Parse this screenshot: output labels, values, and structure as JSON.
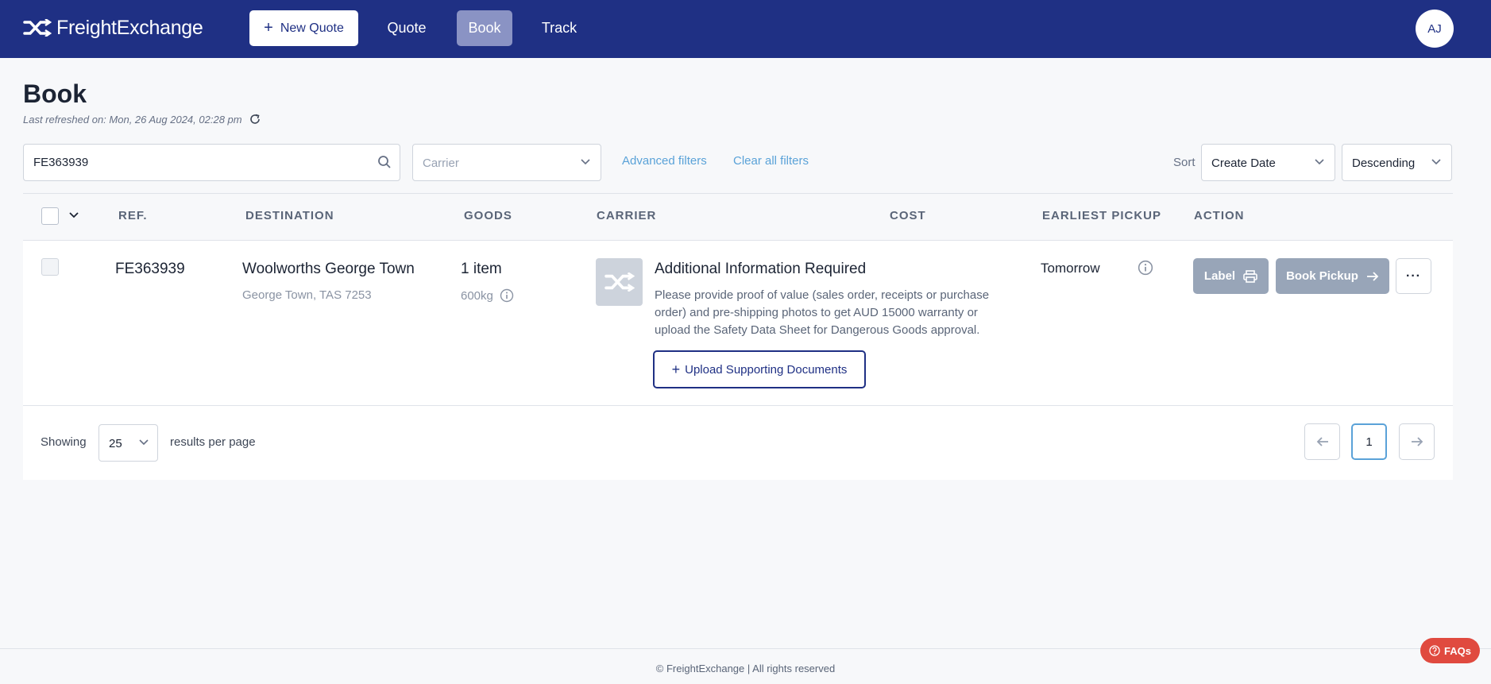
{
  "header": {
    "brand": "FreightExchange",
    "new_quote_label": "New Quote",
    "nav": {
      "quote": "Quote",
      "book": "Book",
      "track": "Track"
    },
    "active_nav": "Book",
    "user_initials": "AJ"
  },
  "page": {
    "title": "Book",
    "last_refreshed": "Last refreshed on: Mon, 26 Aug 2024, 02:28 pm"
  },
  "filters": {
    "search_value": "FE363939",
    "carrier_placeholder": "Carrier",
    "advanced_filters_label": "Advanced filters",
    "clear_filters_label": "Clear all filters",
    "sort_label": "Sort",
    "sort_by": "Create Date",
    "sort_order": "Descending"
  },
  "table": {
    "columns": {
      "ref": "REF.",
      "destination": "DESTINATION",
      "goods": "GOODS",
      "carrier": "CARRIER",
      "cost": "COST",
      "earliest_pickup": "EARLIEST PICKUP",
      "action": "ACTION"
    },
    "rows": [
      {
        "ref": "FE363939",
        "destination_name": "Woolworths George Town",
        "destination_location": "George Town, TAS 7253",
        "goods_count": "1 item",
        "goods_weight": "600kg",
        "carrier_title": "Additional Information Required",
        "carrier_message": "Please provide proof of value (sales order, receipts or purchase order) and pre-shipping photos to get AUD 15000 warranty or upload the Safety Data Sheet for Dangerous Goods approval.",
        "upload_label": "Upload Supporting Documents",
        "earliest_pickup": "Tomorrow",
        "label_button": "Label",
        "book_pickup_button": "Book Pickup"
      }
    ]
  },
  "pagination": {
    "showing_label": "Showing",
    "per_page": "25",
    "per_page_suffix": "results per page",
    "current_page": "1"
  },
  "footer": {
    "copyright": "© FreightExchange | All rights reserved",
    "faq_label": "FAQs"
  },
  "colors": {
    "nav_bg": "#1f3084",
    "active_nav_bg": "#8a93c4",
    "link": "#5aa2d8",
    "disabled_button": "#98a5b8",
    "faq_bg": "#e04a3f"
  },
  "icons": [
    "shuffle-logo-icon",
    "plus-icon",
    "refresh-icon",
    "search-icon",
    "chevron-down-icon",
    "info-icon",
    "printer-icon",
    "arrow-right-icon",
    "more-icon",
    "arrow-left-icon",
    "help-circle-icon"
  ]
}
